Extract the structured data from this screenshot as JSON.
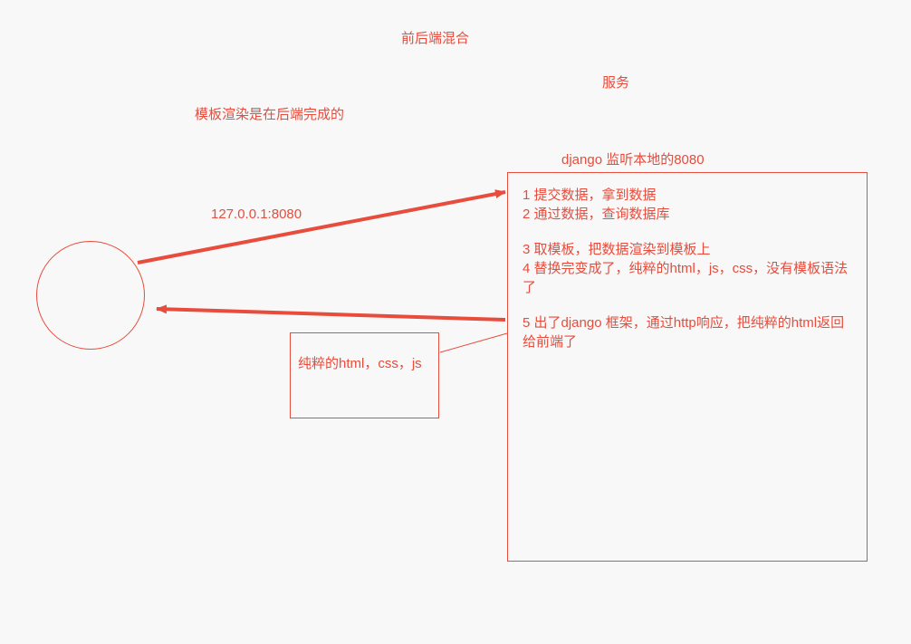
{
  "title": "前后端混合",
  "service_label": "服务",
  "template_note": "模板渲染是在后端完成的",
  "client_addr": "127.0.0.1:8080",
  "django_label": "django    监听本地的8080",
  "steps": {
    "s1": "1 提交数据，拿到数据",
    "s2": "2 通过数据，查询数据库",
    "s3": "3 取模板，把数据渲染到模板上",
    "s4": "4 替换完变成了，纯粹的html，js，css，没有模板语法了",
    "s5": "5 出了django 框架，通过http响应，把纯粹的html返回给前端了"
  },
  "pure_label": "纯粹的html，css，js",
  "colors": {
    "stroke": "#e74c3c",
    "bg": "#f8f8f8"
  }
}
